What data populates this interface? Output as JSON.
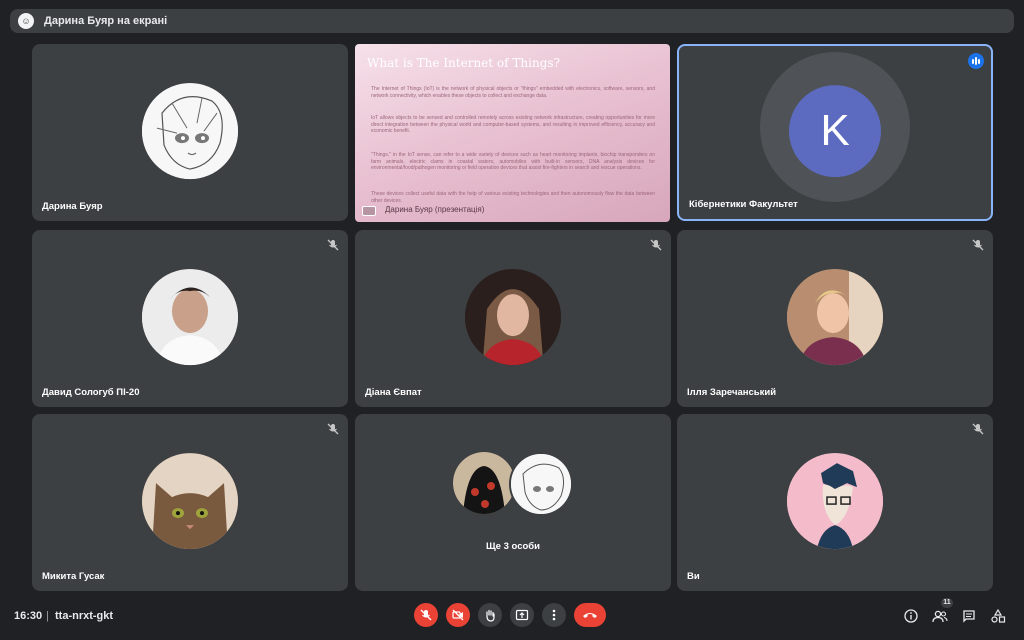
{
  "banner": {
    "text": "Дарина Буяр на екрані",
    "icon": "presenter-avatar"
  },
  "slide": {
    "title": "What is The Internet of Things?",
    "paragraphs": [
      "The Internet of Things (IoT) is the network of physical objects or \"things\" embedded with electronics, software, sensors, and network connectivity, which enables these objects to collect and exchange data.",
      "IoT allows objects to be sensed and controlled remotely across existing network infrastructure, creating opportunities for more direct integration between the physical world and computer-based systems, and resulting in improved efficiency, accuracy and economic benefit.",
      "\"Things,\" in the IoT sense, can refer to a wide variety of devices such as heart monitoring implants, biochip transponders on farm animals, electric clams in coastal waters, automobiles with built-in sensors, DNA analysis devices for environmental/food/pathogen monitoring or field operation devices that assist fire-fighters in search and rescue operations.",
      "These devices collect useful data with the help of various existing technologies and then autonomously flow the data between other devices."
    ],
    "presenter_label": "Дарина Буяр (презентація)"
  },
  "tiles": {
    "t1": {
      "name": "Дарина Буяр"
    },
    "t3": {
      "name": "Кібернетики Факультет",
      "initial": "K",
      "avatar_color": "#5c6bc0"
    },
    "t4": {
      "name": "Давид Сологуб ПІ-20"
    },
    "t5": {
      "name": "Діана Євпат"
    },
    "t6": {
      "name": "Ілля Заречанський"
    },
    "t7": {
      "name": "Микита Гусак"
    },
    "t8": {
      "label": "Ще 3 особи"
    },
    "t9": {
      "name": "Ви"
    }
  },
  "bottom": {
    "time": "16:30",
    "separator": "|",
    "meeting_code": "tta-nrxt-gkt",
    "controls": [
      "mic-off-icon",
      "camera-off-icon",
      "raise-hand-icon",
      "present-icon",
      "more-options-icon",
      "end-call-icon"
    ],
    "right_icons": [
      "info-icon",
      "people-icon",
      "chat-icon",
      "activities-icon"
    ],
    "participants_count": "11"
  },
  "colors": {
    "background": "#202124",
    "tile": "#3c4043",
    "red": "#ea4335",
    "active_border": "#8ab4f8",
    "speaking": "#1a73e8"
  }
}
